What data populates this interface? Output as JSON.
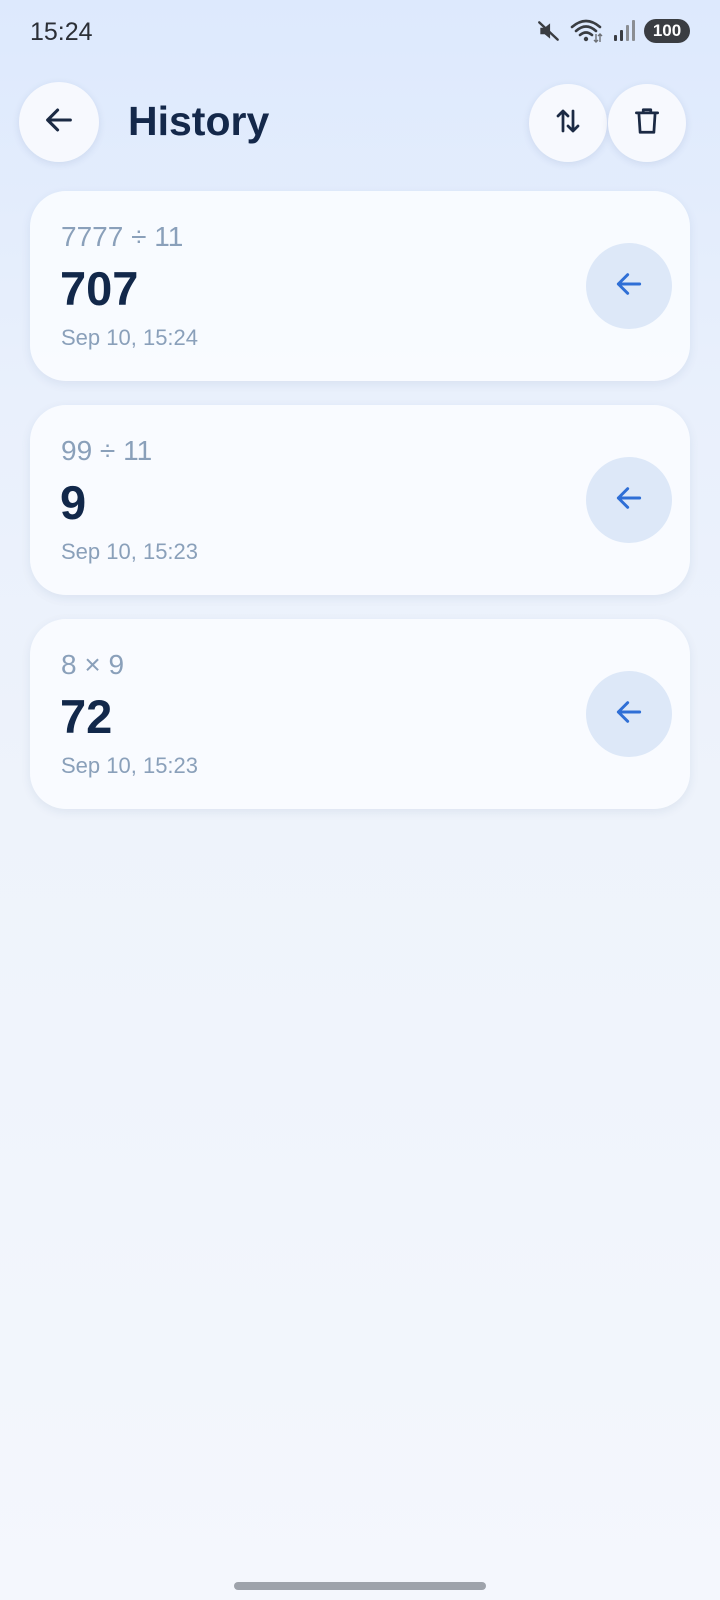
{
  "status_bar": {
    "time": "15:24",
    "battery": "100",
    "icons": [
      "mute-icon",
      "wifi-icon",
      "signal-icon",
      "battery-icon"
    ]
  },
  "header": {
    "title": "History",
    "icons": [
      "back-arrow-icon",
      "sort-icon",
      "trash-icon"
    ]
  },
  "history": [
    {
      "expression": "7777 ÷ 11",
      "result": "707",
      "time": "Sep 10, 15:24"
    },
    {
      "expression": "99 ÷ 11",
      "result": "9",
      "time": "Sep 10, 15:23"
    },
    {
      "expression": "8 × 9",
      "result": "72",
      "time": "Sep 10, 15:23"
    }
  ],
  "colors": {
    "accent": "#2f6fd6",
    "title": "#14284a",
    "muted": "#8aa0ba"
  }
}
